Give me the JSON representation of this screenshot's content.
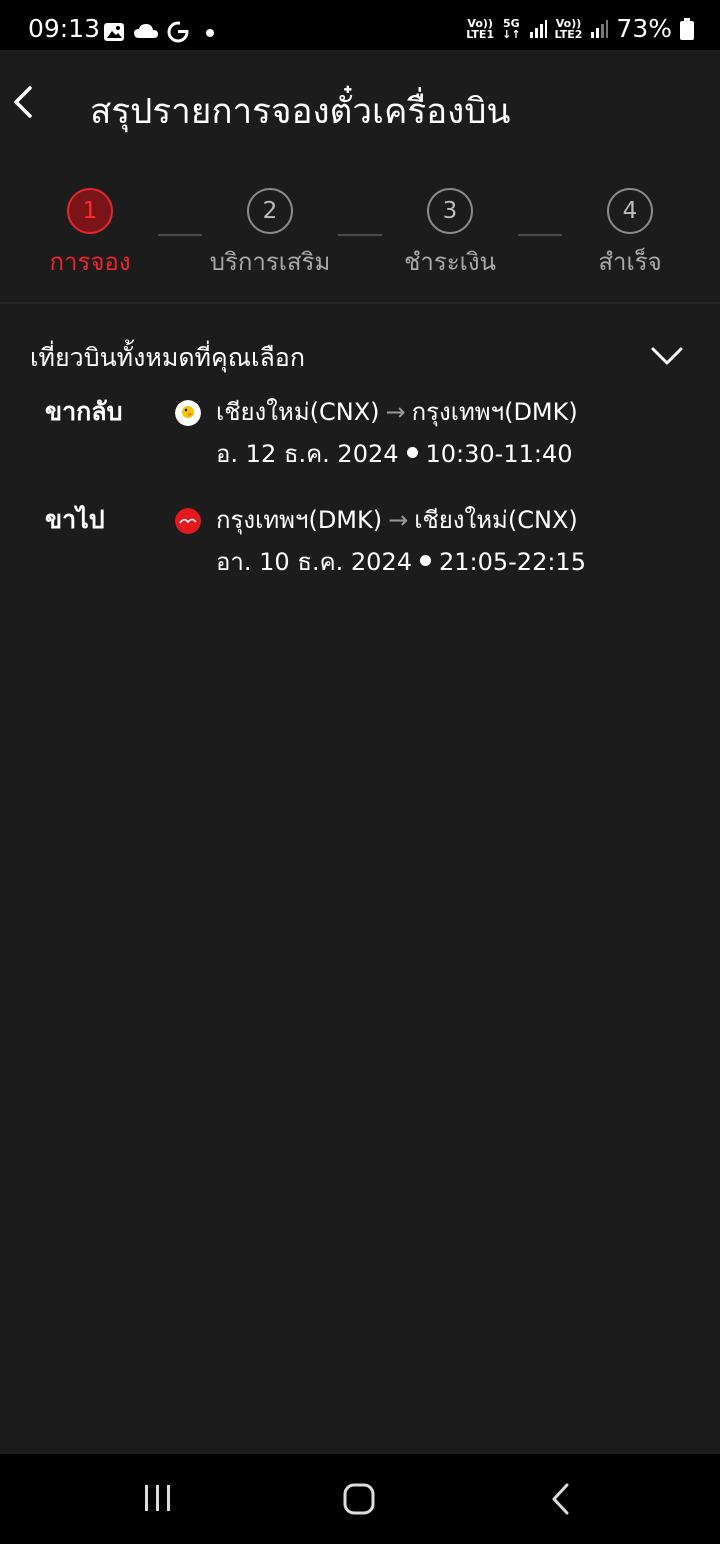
{
  "status_bar": {
    "time": "09:13",
    "sim1_top": "Vo))",
    "sim1_bottom": "LTE1",
    "network_5g": "5G",
    "sim2_top": "Vo))",
    "sim2_bottom": "LTE2",
    "battery": "73%",
    "icons": [
      "gallery-icon",
      "cloud-icon",
      "g-app-icon",
      "notification-dot-icon",
      "signal-icon",
      "battery-icon"
    ]
  },
  "header": {
    "title": "สรุปรายการจองตั๋วเครื่องบิน",
    "back_icon": "chevron-left-icon"
  },
  "stepper": {
    "steps": [
      {
        "number": "1",
        "label": "การจอง",
        "active": true
      },
      {
        "number": "2",
        "label": "บริการเสริม",
        "active": false
      },
      {
        "number": "3",
        "label": "ชำระเงิน",
        "active": false
      },
      {
        "number": "4",
        "label": "สำเร็จ",
        "active": false
      }
    ]
  },
  "flights_section": {
    "title": "เที่ยวบินทั้งหมดที่คุณเลือก",
    "toggle_icon": "chevron-down-icon",
    "flights": [
      {
        "leg": "ขากลับ",
        "airline_icon": "nok-air-logo-icon",
        "from": "เชียงใหม่(CNX)",
        "to": "กรุงเทพฯ(DMK)",
        "date": "อ. 12 ธ.ค. 2024",
        "time": "10:30-11:40"
      },
      {
        "leg": "ขาไป",
        "airline_icon": "airasia-logo-icon",
        "from": "กรุงเทพฯ(DMK)",
        "to": "เชียงใหม่(CNX)",
        "date": "อา. 10 ธ.ค. 2024",
        "time": "21:05-22:15"
      }
    ]
  },
  "colors": {
    "background": "#1c1c1c",
    "accent": "#f0222a",
    "text": "#ffffff",
    "muted": "#a9a9a9"
  },
  "nav_bar": {
    "buttons": [
      "recent-apps-icon",
      "home-icon",
      "back-icon"
    ]
  }
}
